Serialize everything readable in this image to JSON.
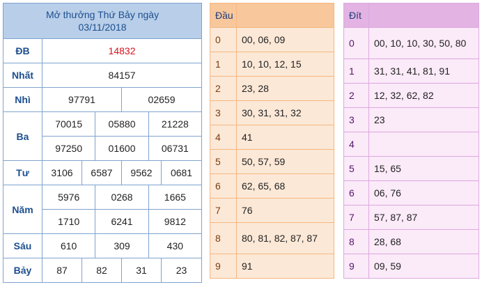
{
  "results": {
    "title_line1": "Mở thưởng Thứ Bảy ngày",
    "title_line2": "03/11/2018",
    "rows": [
      {
        "label": "ĐB",
        "values": [
          "14832"
        ]
      },
      {
        "label": "Nhất",
        "values": [
          "84157"
        ]
      },
      {
        "label": "Nhì",
        "values": [
          "97791",
          "02659"
        ]
      },
      {
        "label": "Ba",
        "values": [
          "70015",
          "05880",
          "21228",
          "97250",
          "01600",
          "06731"
        ]
      },
      {
        "label": "Tư",
        "values": [
          "3106",
          "6587",
          "9562",
          "0681"
        ]
      },
      {
        "label": "Năm",
        "values": [
          "5976",
          "0268",
          "1665",
          "1710",
          "6241",
          "9812"
        ]
      },
      {
        "label": "Sáu",
        "values": [
          "610",
          "309",
          "430"
        ]
      },
      {
        "label": "Bảy",
        "values": [
          "87",
          "82",
          "31",
          "23"
        ]
      }
    ],
    "special_color": "#d4141b"
  },
  "dau": {
    "header": "Đầu",
    "rows": [
      {
        "k": "0",
        "v": "00, 06, 09"
      },
      {
        "k": "1",
        "v": "10, 10, 12, 15"
      },
      {
        "k": "2",
        "v": "23, 28"
      },
      {
        "k": "3",
        "v": "30, 31, 31, 32"
      },
      {
        "k": "4",
        "v": "41"
      },
      {
        "k": "5",
        "v": "50, 57, 59"
      },
      {
        "k": "6",
        "v": "62, 65, 68"
      },
      {
        "k": "7",
        "v": "76"
      },
      {
        "k": "8",
        "v": "80, 81, 82, 87, 87"
      },
      {
        "k": "9",
        "v": "91"
      }
    ]
  },
  "dit": {
    "header": "Đít",
    "rows": [
      {
        "k": "0",
        "v": "00, 10, 10, 30, 50, 80"
      },
      {
        "k": "1",
        "v": "31, 31, 41, 81, 91"
      },
      {
        "k": "2",
        "v": "12, 32, 62, 82"
      },
      {
        "k": "3",
        "v": "23"
      },
      {
        "k": "4",
        "v": ""
      },
      {
        "k": "5",
        "v": "15, 65"
      },
      {
        "k": "6",
        "v": "06, 76"
      },
      {
        "k": "7",
        "v": "57, 87, 87"
      },
      {
        "k": "8",
        "v": "28, 68"
      },
      {
        "k": "9",
        "v": "09, 59"
      }
    ]
  }
}
